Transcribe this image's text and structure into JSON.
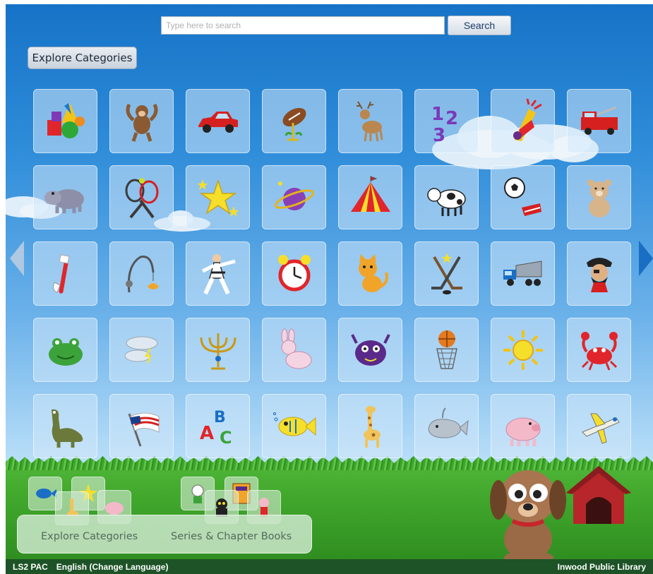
{
  "search": {
    "placeholder": "Type here to search",
    "button_label": "Search"
  },
  "explore_button_label": "Explore Categories",
  "categories": [
    {
      "icon": "shapes-icon"
    },
    {
      "icon": "monkey-icon"
    },
    {
      "icon": "car-icon"
    },
    {
      "icon": "football-icon"
    },
    {
      "icon": "deer-icon"
    },
    {
      "icon": "numbers-icon"
    },
    {
      "icon": "fireworks-icon"
    },
    {
      "icon": "fire-truck-icon"
    },
    {
      "icon": "hippo-icon"
    },
    {
      "icon": "tennis-rackets-icon"
    },
    {
      "icon": "stars-icon"
    },
    {
      "icon": "planet-icon"
    },
    {
      "icon": "circus-tent-icon"
    },
    {
      "icon": "cow-icon"
    },
    {
      "icon": "soccer-icon"
    },
    {
      "icon": "teddy-bear-icon"
    },
    {
      "icon": "toothbrush-icon"
    },
    {
      "icon": "fishing-rod-icon"
    },
    {
      "icon": "karate-icon"
    },
    {
      "icon": "alarm-clock-icon"
    },
    {
      "icon": "cat-icon"
    },
    {
      "icon": "hockey-icon"
    },
    {
      "icon": "dump-truck-icon"
    },
    {
      "icon": "pirate-icon"
    },
    {
      "icon": "frog-icon"
    },
    {
      "icon": "weather-icon"
    },
    {
      "icon": "menorah-icon"
    },
    {
      "icon": "bunny-icon"
    },
    {
      "icon": "monster-icon"
    },
    {
      "icon": "basketball-icon"
    },
    {
      "icon": "sun-icon"
    },
    {
      "icon": "crab-icon"
    },
    {
      "icon": "dinosaur-icon"
    },
    {
      "icon": "flag-icon"
    },
    {
      "icon": "abc-icon"
    },
    {
      "icon": "fish-icon"
    },
    {
      "icon": "giraffe-icon"
    },
    {
      "icon": "whale-icon"
    },
    {
      "icon": "pig-icon"
    },
    {
      "icon": "airplane-icon"
    }
  ],
  "bottom_nav": {
    "explore_label": "Explore Categories",
    "series_label": "Series & Chapter Books"
  },
  "footer": {
    "app_name": "LS2 PAC",
    "language": "English (Change Language)",
    "library": "Inwood Public Library"
  },
  "colors": {
    "sky_top": "#1673c7",
    "grass": "#3fa52b",
    "footer": "#1d5326",
    "accent_arrow": "#1a6fc4"
  }
}
